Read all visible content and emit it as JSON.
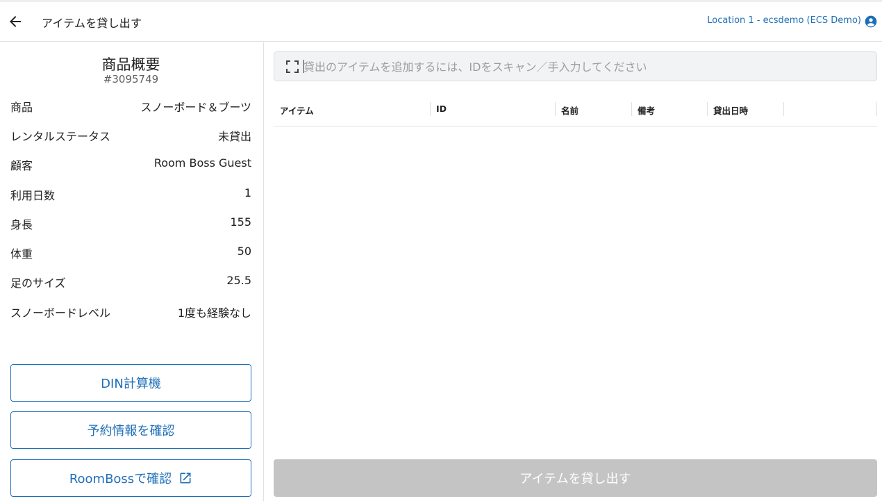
{
  "header": {
    "title": "アイテムを貸し出す",
    "location": "Location 1 - ecsdemo (ECS Demo)",
    "back_icon": "arrow-left-icon",
    "account_icon": "account-circle-icon"
  },
  "summary": {
    "title": "商品概要",
    "order_number": "#3095749",
    "rows": [
      {
        "label": "商品",
        "value": "スノーボード＆ブーツ"
      },
      {
        "label": "レンタルステータス",
        "value": "未貸出"
      },
      {
        "label": "顧客",
        "value": "Room Boss Guest"
      },
      {
        "label": "利用日数",
        "value": "1"
      },
      {
        "label": "身長",
        "value": "155"
      },
      {
        "label": "体重",
        "value": "50"
      },
      {
        "label": "足のサイズ",
        "value": "25.5"
      },
      {
        "label": "スノーボードレベル",
        "value": "1度も経験なし"
      }
    ]
  },
  "actions": {
    "din_calculator": "DIN計算機",
    "check_reservation": "予約情報を確認",
    "check_roomboss": "RoomBossで確認",
    "external_link_icon": "open-in-new-icon"
  },
  "scan": {
    "placeholder": "貸出のアイテムを追加するには、IDをスキャン／手入力してください",
    "value": "",
    "icon": "scan-frame-icon"
  },
  "table": {
    "columns": [
      "アイテム",
      "ID",
      "名前",
      "備考",
      "貸出日時",
      ""
    ],
    "rows": []
  },
  "submit": {
    "label": "アイテムを貸し出す",
    "disabled": true
  },
  "colors": {
    "accent": "#1e6fb8",
    "disabled_button": "#c4c4c4",
    "input_background": "#f2f3f4"
  }
}
